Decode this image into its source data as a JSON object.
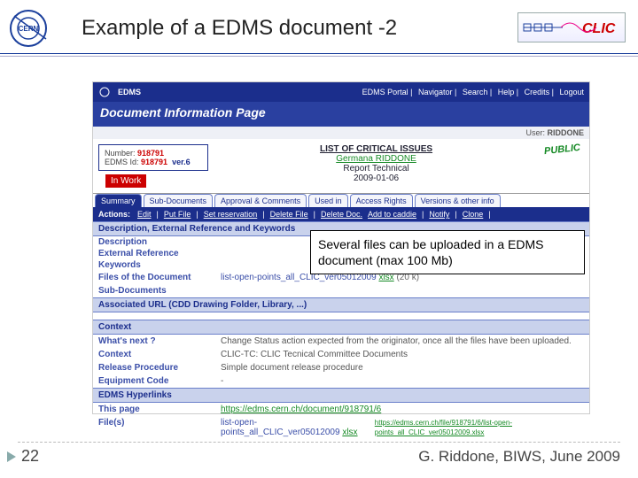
{
  "title": "Example of a EDMS document -2",
  "page_number": "22",
  "footer": "G. Riddone, BIWS, June 2009",
  "callout": "Several files can be uploaded in a EDMS document (max 100 Mb)",
  "logos": {
    "cern": "CERN",
    "clic": "CLIC"
  },
  "edms": {
    "portal_links": [
      "EDMS Portal",
      "Navigator",
      "Search",
      "Help",
      "Credits",
      "Logout"
    ],
    "badge": "EDMS",
    "dip_title": "Document Information Page",
    "user_prefix": "User:",
    "user": "RIDDONE",
    "numbox": {
      "number_lbl": "Number:",
      "number": "918791",
      "edms_lbl": "EDMS Id:",
      "edms": "918791",
      "ver": "ver.6"
    },
    "status": "In Work",
    "doc": {
      "title": "LIST OF CRITICAL ISSUES",
      "author": "Germana RIDDONE",
      "type": "Report   Technical",
      "date": "2009-01-06"
    },
    "public": "PUBLIC",
    "tabs": [
      "Summary",
      "Sub-Documents",
      "Approval & Comments",
      "Used in",
      "Access Rights",
      "Versions & other info"
    ],
    "actions_lbl": "Actions:",
    "actions": [
      "Edit",
      "Put File",
      "Set reservation",
      "Delete File",
      "Delete Doc.",
      "Add to caddie",
      "|",
      "Notify",
      "Clone",
      "|"
    ],
    "sect_desc": "Description, External Reference and Keywords",
    "fields": [
      "Description",
      "External Reference",
      "Keywords"
    ],
    "files_lbl": "Files of the Document",
    "file_main": "list-open-points_all_CLIC_ver05012009",
    "file_ext": "xlsx",
    "file_size": "(20 k)",
    "subdocs_lbl": "Sub-Documents",
    "assoc_sect": "Associated URL (CDD Drawing Folder, Library, ...)",
    "context_sect": "Context",
    "whats_next_lbl": "What's next ?",
    "whats_next": "Change Status action expected from the originator, once all the files have been uploaded.",
    "ctx_lbl": "Context",
    "ctx_val": "CLIC-TC: CLIC Tecnical Committee Documents",
    "rel_lbl": "Release Procedure",
    "rel_val": "Simple document release procedure",
    "eq_lbl": "Equipment Code",
    "eq_val": "-",
    "links_sect": "EDMS Hyperlinks",
    "thispage_lbl": "This page",
    "thispage_url": "https://edms.cern.ch/document/918791/6",
    "files2_lbl": "File(s)",
    "file2_name": "list-open-points_all_CLIC_ver05012009",
    "file2_ext": "xlsx",
    "file2_url": "https://edms.cern.ch/file/918791/6/list-open-points_all_CLIC_ver05012009.xlsx"
  }
}
